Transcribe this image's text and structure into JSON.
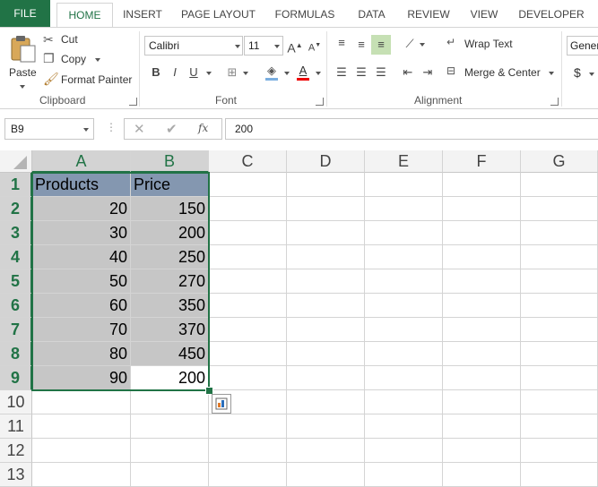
{
  "tabs": [
    "FILE",
    "HOME",
    "INSERT",
    "PAGE LAYOUT",
    "FORMULAS",
    "DATA",
    "REVIEW",
    "VIEW",
    "DEVELOPER"
  ],
  "active_tab": "HOME",
  "clipboard": {
    "paste": "Paste",
    "cut": "Cut",
    "copy": "Copy",
    "format_painter": "Format Painter",
    "label": "Clipboard"
  },
  "font": {
    "name": "Calibri",
    "size": "11",
    "label": "Font",
    "bold": "B",
    "italic": "I",
    "underline": "U"
  },
  "alignment": {
    "wrap_text": "Wrap Text",
    "merge_center": "Merge & Center",
    "label": "Alignment"
  },
  "number": {
    "format": "Gener",
    "currency": "$"
  },
  "name_box": "B9",
  "formula_fx": "fx",
  "formula_value": "200",
  "columns": [
    "A",
    "B",
    "C",
    "D",
    "E",
    "F",
    "G"
  ],
  "rows": [
    "1",
    "2",
    "3",
    "4",
    "5",
    "6",
    "7",
    "8",
    "9",
    "10",
    "11",
    "12",
    "13"
  ],
  "header": [
    "Products",
    "Price"
  ],
  "data": [
    [
      "20",
      "150"
    ],
    [
      "30",
      "200"
    ],
    [
      "40",
      "250"
    ],
    [
      "50",
      "270"
    ],
    [
      "60",
      "350"
    ],
    [
      "70",
      "370"
    ],
    [
      "80",
      "450"
    ],
    [
      "90",
      "200"
    ]
  ],
  "colors": {
    "accent": "#217346",
    "header_fill": "#8497b0",
    "selection_fill": "#c6c6c6"
  }
}
